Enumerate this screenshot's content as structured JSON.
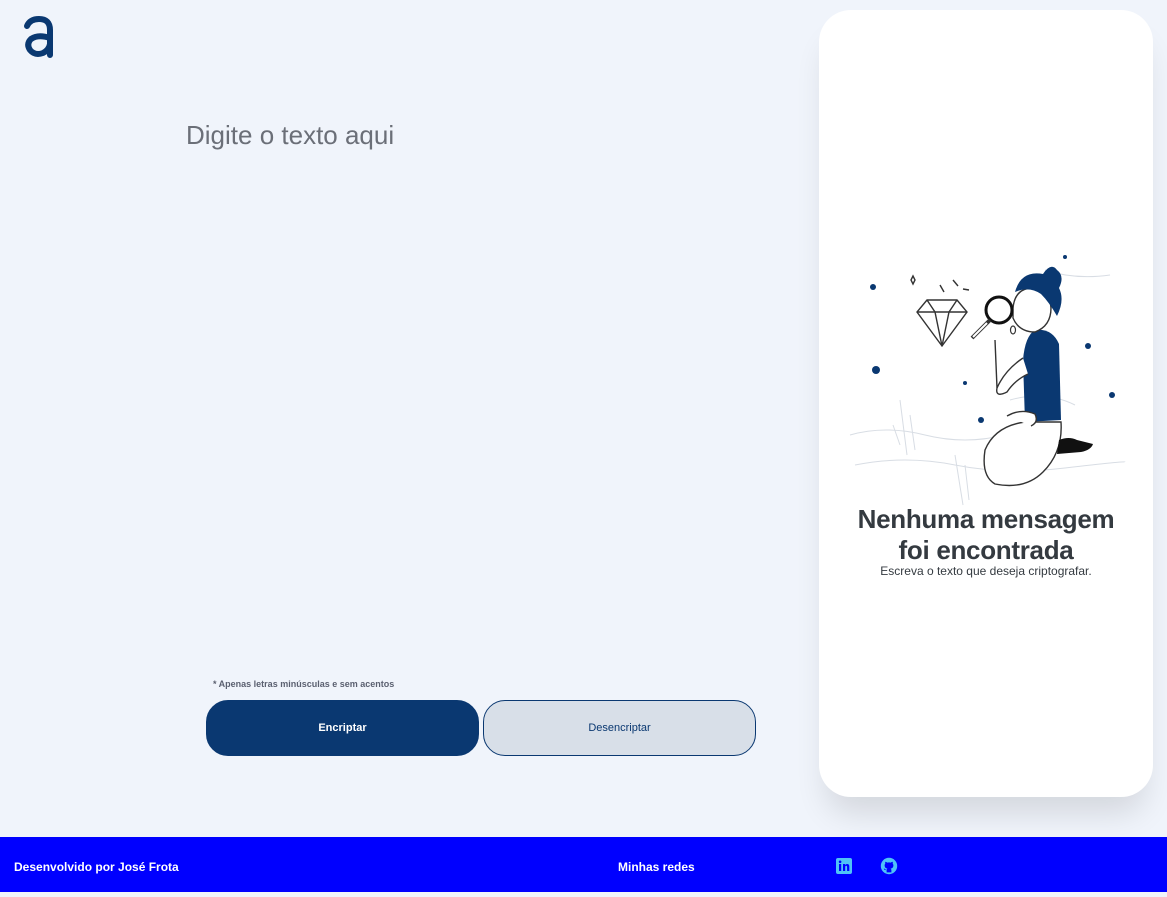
{
  "brand": {
    "logo_letter": "a",
    "accent": "#0a3871"
  },
  "input": {
    "placeholder": "Digite o texto aqui"
  },
  "hint": {
    "text": "* Apenas letras minúsculas e sem acentos"
  },
  "buttons": {
    "encrypt_label": "Encriptar",
    "decrypt_label": "Desencriptar"
  },
  "output": {
    "title_line1": "Nenhuma mensagem",
    "title_line2": "foi encontrada",
    "subtitle": "Escreva o texto que deseja criptografar."
  },
  "footer": {
    "credit": "Desenvolvido por José Frota",
    "networks_label": "Minhas redes",
    "icons": [
      "linkedin-icon",
      "github-icon"
    ],
    "background": "#0000ff"
  }
}
